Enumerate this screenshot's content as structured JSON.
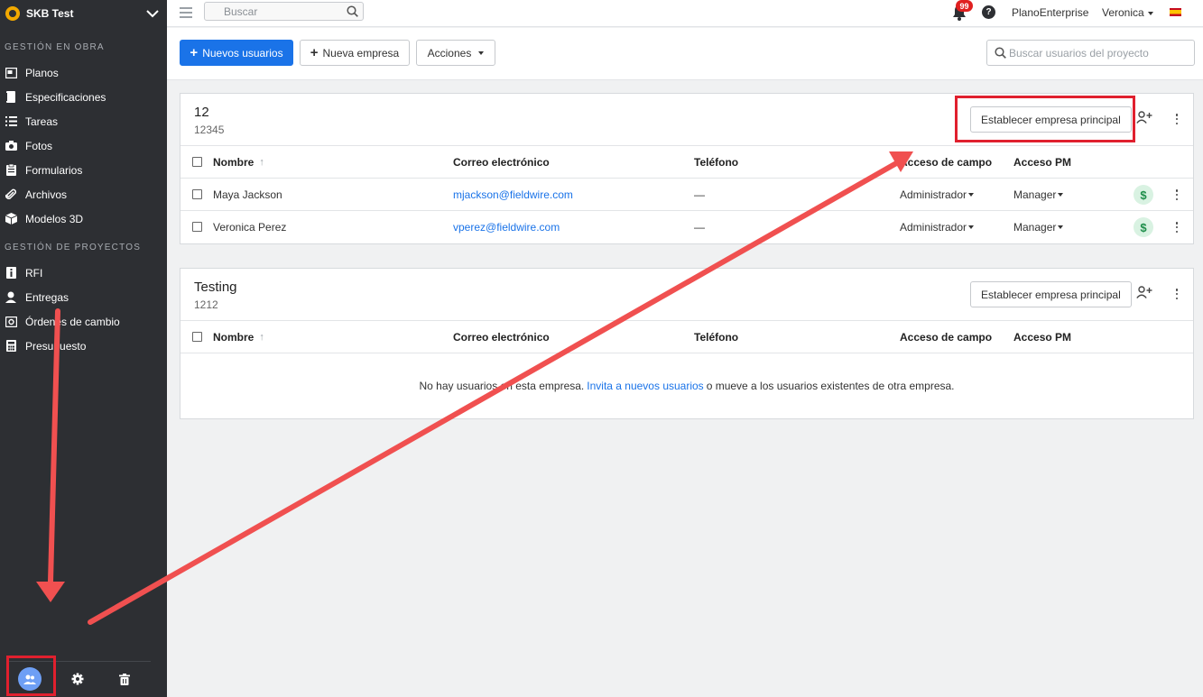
{
  "project": {
    "name": "SKB Test"
  },
  "sidebar": {
    "sections": [
      {
        "title": "GESTIÓN EN OBRA",
        "items": [
          {
            "label": "Planos",
            "icon": "plans-icon"
          },
          {
            "label": "Especificaciones",
            "icon": "specs-icon"
          },
          {
            "label": "Tareas",
            "icon": "tasks-icon"
          },
          {
            "label": "Fotos",
            "icon": "camera-icon"
          },
          {
            "label": "Formularios",
            "icon": "forms-icon"
          },
          {
            "label": "Archivos",
            "icon": "paperclip-icon"
          },
          {
            "label": "Modelos 3D",
            "icon": "cube-icon"
          }
        ]
      },
      {
        "title": "GESTIÓN DE PROYECTOS",
        "items": [
          {
            "label": "RFI",
            "icon": "rfi-icon"
          },
          {
            "label": "Entregas",
            "icon": "submittal-icon"
          },
          {
            "label": "Órdenes de cambio",
            "icon": "change-order-icon"
          },
          {
            "label": "Presupuesto",
            "icon": "calculator-icon"
          }
        ]
      }
    ],
    "bottom": [
      "users-icon",
      "gear-icon",
      "trash-icon"
    ]
  },
  "topbar": {
    "search_placeholder": "Buscar",
    "notifications_count": "99",
    "help_label": "?",
    "plan": "PlanoEnterprise",
    "user": "Veronica"
  },
  "toolbar": {
    "new_users": "Nuevos usuarios",
    "new_company": "Nueva empresa",
    "actions": "Acciones",
    "search_placeholder": "Buscar usuarios del proyecto"
  },
  "columns": {
    "name": "Nombre",
    "email": "Correo electrónico",
    "phone": "Teléfono",
    "field_access": "Acceso de campo",
    "pm_access": "Acceso PM"
  },
  "companies": [
    {
      "name": "12",
      "code": "12345",
      "set_main_label": "Establecer empresa principal",
      "users": [
        {
          "name": "Maya Jackson",
          "email": "mjackson@fieldwire.com",
          "phone": "—",
          "field_access": "Administrador",
          "pm_access": "Manager"
        },
        {
          "name": "Veronica Perez",
          "email": "vperez@fieldwire.com",
          "phone": "—",
          "field_access": "Administrador",
          "pm_access": "Manager"
        }
      ]
    },
    {
      "name": "Testing",
      "code": "1212",
      "set_main_label": "Establecer empresa principal",
      "users": [],
      "empty": {
        "before": "No hay usuarios en esta empresa.",
        "link": "Invita a nuevos usuarios",
        "after": "o mueve a los usuarios existentes de otra empresa."
      }
    }
  ],
  "colors": {
    "primary": "#1a73e8",
    "sidebar": "#2d2f33",
    "annotation": "#e0202e"
  }
}
